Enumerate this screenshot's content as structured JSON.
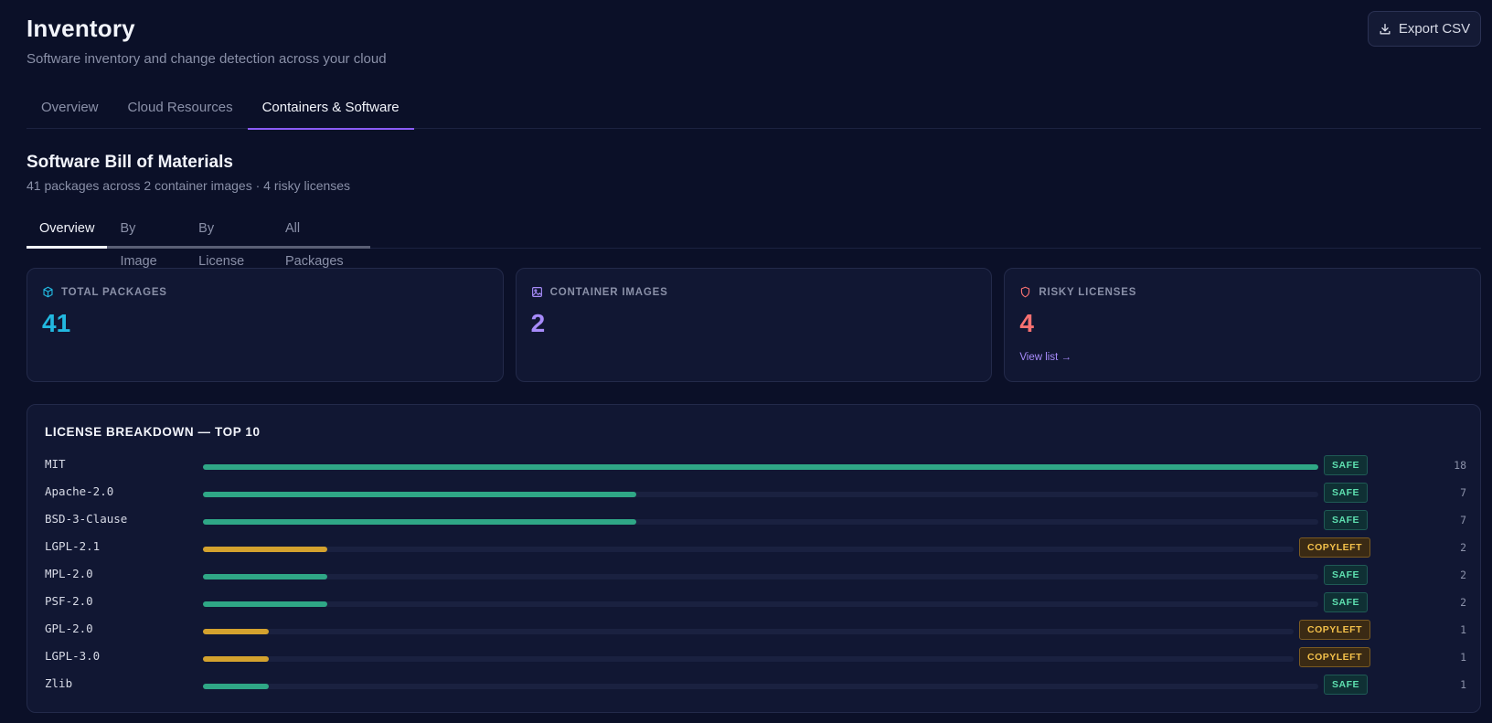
{
  "header": {
    "title": "Inventory",
    "subtitle": "Software inventory and change detection across your cloud",
    "export_label": "Export CSV"
  },
  "top_tabs": [
    {
      "label": "Overview",
      "active": false
    },
    {
      "label": "Cloud Resources",
      "active": false
    },
    {
      "label": "Containers & Software",
      "active": true
    }
  ],
  "section": {
    "title": "Software Bill of Materials",
    "subtitle": "41 packages across 2 container images · 4 risky licenses"
  },
  "sub_tabs": [
    {
      "label": "Overview",
      "active": true
    },
    {
      "label": "By Image",
      "active": false
    },
    {
      "label": "By License",
      "active": false
    },
    {
      "label": "All Packages",
      "active": false
    }
  ],
  "cards": {
    "total_packages": {
      "label": "TOTAL PACKAGES",
      "value": "41",
      "color": "#22b8e0",
      "icon": "cube-icon"
    },
    "container_images": {
      "label": "CONTAINER IMAGES",
      "value": "2",
      "color": "#a78bfa",
      "icon": "image-icon"
    },
    "risky_licenses": {
      "label": "RISKY LICENSES",
      "value": "4",
      "color": "#f87171",
      "icon": "shield-icon",
      "link": "View list →"
    }
  },
  "license_breakdown": {
    "title": "LICENSE BREAKDOWN — TOP 10",
    "max_count": 18,
    "colors": {
      "safe": "#2fa786",
      "copyleft": "#d4a22e"
    },
    "rows": [
      {
        "name": "MIT",
        "count": 18,
        "badge": "SAFE",
        "kind": "safe"
      },
      {
        "name": "Apache-2.0",
        "count": 7,
        "badge": "SAFE",
        "kind": "safe"
      },
      {
        "name": "BSD-3-Clause",
        "count": 7,
        "badge": "SAFE",
        "kind": "safe"
      },
      {
        "name": "LGPL-2.1",
        "count": 2,
        "badge": "COPYLEFT",
        "kind": "copyleft"
      },
      {
        "name": "MPL-2.0",
        "count": 2,
        "badge": "SAFE",
        "kind": "safe"
      },
      {
        "name": "PSF-2.0",
        "count": 2,
        "badge": "SAFE",
        "kind": "safe"
      },
      {
        "name": "GPL-2.0",
        "count": 1,
        "badge": "COPYLEFT",
        "kind": "copyleft"
      },
      {
        "name": "LGPL-3.0",
        "count": 1,
        "badge": "COPYLEFT",
        "kind": "copyleft"
      },
      {
        "name": "Zlib",
        "count": 1,
        "badge": "SAFE",
        "kind": "safe"
      }
    ]
  }
}
